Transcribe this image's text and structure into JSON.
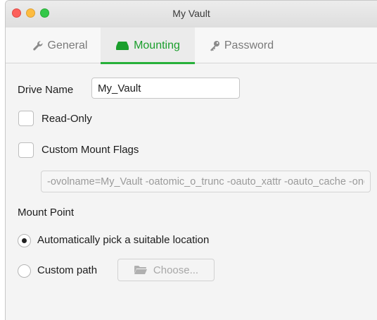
{
  "window": {
    "title": "My Vault"
  },
  "tabs": [
    {
      "label": "General",
      "icon": "wrench-icon",
      "active": false
    },
    {
      "label": "Mounting",
      "icon": "drive-icon",
      "active": true
    },
    {
      "label": "Password",
      "icon": "key-icon",
      "active": false
    }
  ],
  "mounting": {
    "drive_name_label": "Drive Name",
    "drive_name_value": "My_Vault",
    "read_only_label": "Read-Only",
    "read_only_checked": false,
    "custom_flags_label": "Custom Mount Flags",
    "custom_flags_checked": false,
    "custom_flags_value": "-ovolname=My_Vault -oatomic_o_trunc -oauto_xattr -oauto_cache -onoappledouble",
    "mount_point_label": "Mount Point",
    "auto_location_label": "Automatically pick a suitable location",
    "auto_location_selected": true,
    "custom_path_label": "Custom path",
    "custom_path_selected": false,
    "choose_button_label": "Choose..."
  },
  "colors": {
    "accent_green": "#27b13a",
    "active_tab_text": "#1a9e2c",
    "close": "#fc605b",
    "minimize": "#fdbc40",
    "maximize": "#34c84a"
  }
}
